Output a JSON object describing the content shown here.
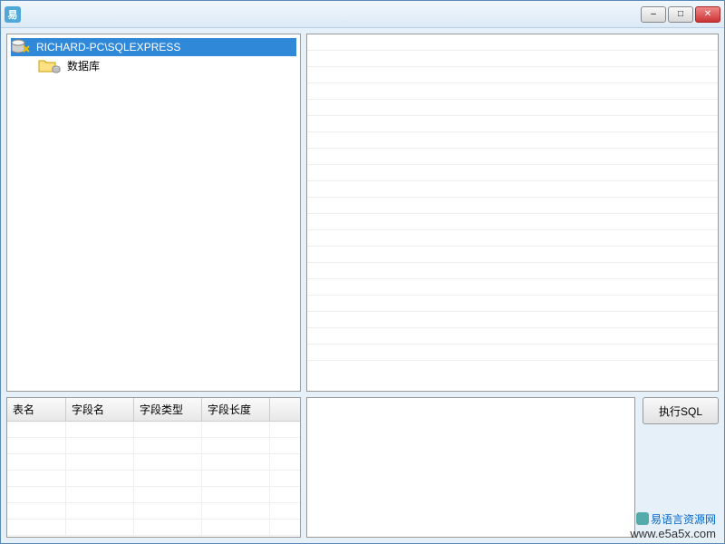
{
  "titlebar": {
    "title": ""
  },
  "window_controls": {
    "min": "–",
    "max": "□",
    "close": "✕"
  },
  "tree": {
    "server": {
      "label": "RICHARD-PC\\SQLEXPRESS",
      "selected": true
    },
    "database_folder": {
      "label": "数据库"
    }
  },
  "table": {
    "columns": [
      "表名",
      "字段名",
      "字段类型",
      "字段长度"
    ]
  },
  "sql": {
    "value": "",
    "execute_label": "执行SQL"
  },
  "watermark": {
    "line1": "易语言资源网",
    "line2": "www.e5a5x.com"
  }
}
